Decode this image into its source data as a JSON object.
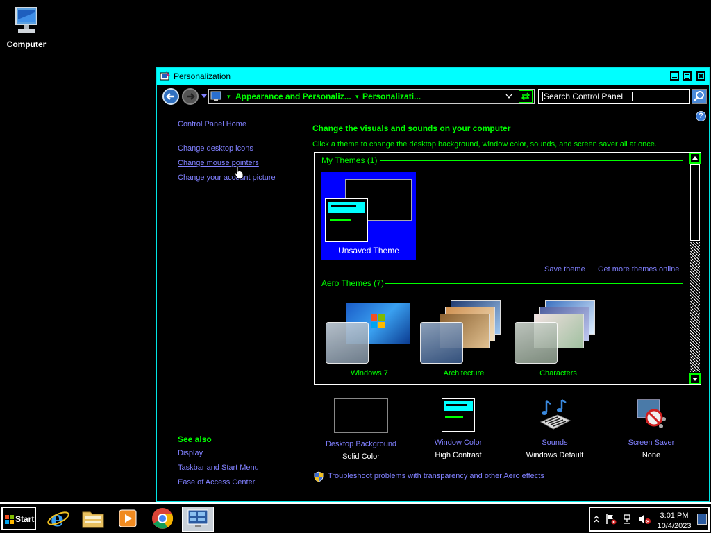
{
  "desktop": {
    "icon_label": "Computer"
  },
  "window": {
    "title": "Personalization",
    "breadcrumb": [
      "Appearance and Personaliz...",
      "Personalizati..."
    ],
    "search_placeholder": "Search Control Panel"
  },
  "sidebar": {
    "home": "Control Panel Home",
    "links": [
      "Change desktop icons",
      "Change mouse pointers",
      "Change your account picture"
    ],
    "see_also_title": "See also",
    "see_also": [
      "Display",
      "Taskbar and Start Menu",
      "Ease of Access Center"
    ]
  },
  "main": {
    "heading": "Change the visuals and sounds on your computer",
    "subheading": "Click a theme to change the desktop background, window color, sounds, and screen saver all at once.",
    "my_themes_title": "My Themes (1)",
    "unsaved_theme": "Unsaved Theme",
    "save_theme": "Save theme",
    "get_more": "Get more themes online",
    "aero_title": "Aero Themes (7)",
    "aero_themes": [
      "Windows 7",
      "Architecture",
      "Characters"
    ]
  },
  "bottom": [
    {
      "label": "Desktop Background",
      "value": "Solid Color"
    },
    {
      "label": "Window Color",
      "value": "High Contrast"
    },
    {
      "label": "Sounds",
      "value": "Windows Default"
    },
    {
      "label": "Screen Saver",
      "value": "None"
    }
  ],
  "troubleshoot": "Troubleshoot problems with transparency and other Aero effects",
  "taskbar": {
    "start": "Start",
    "time": "3:01 PM",
    "date": "10/4/2023"
  },
  "colors": {
    "accent": "#00ffff",
    "link": "#8080ff",
    "heading": "#00ff00",
    "theme_tile": "#0000ff"
  }
}
